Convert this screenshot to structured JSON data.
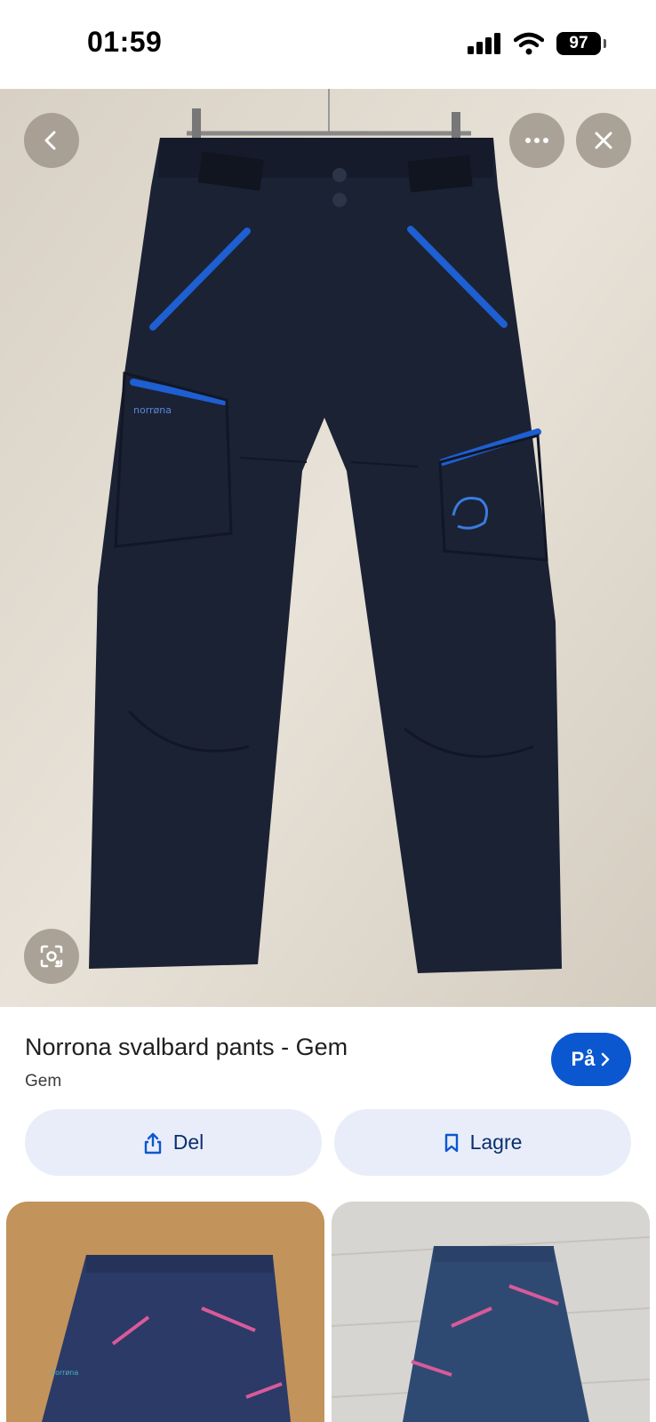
{
  "status_bar": {
    "time": "01:59",
    "battery": "97"
  },
  "hero": {
    "back_icon": "chevron-left-icon",
    "more_icon": "more-horizontal-icon",
    "close_icon": "close-icon",
    "lens_icon": "lens-search-icon"
  },
  "result": {
    "title": "Norrona svalbard pants - Gem",
    "source": "Gem",
    "visit_label": "På",
    "share_label": "Del",
    "save_label": "Lagre"
  },
  "colors": {
    "accent": "#0b57d0",
    "chip_bg": "#e8edf9",
    "pants": "#1b2234",
    "zip": "#1e5fd1"
  }
}
